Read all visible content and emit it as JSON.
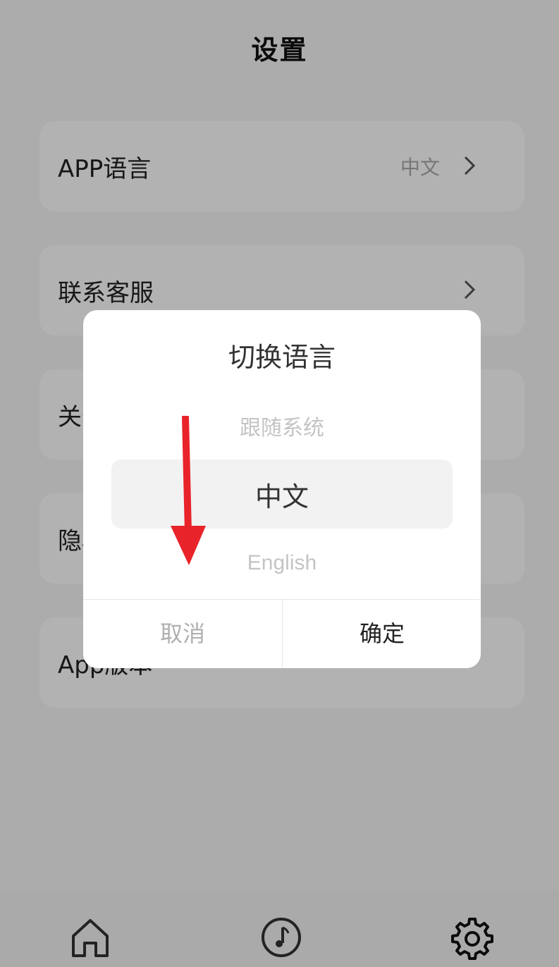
{
  "header": {
    "title": "设置"
  },
  "settings": {
    "items": [
      {
        "label": "APP语言",
        "value": "中文"
      },
      {
        "label": "联系客服",
        "value": ""
      },
      {
        "label": "关于我们",
        "value": ""
      },
      {
        "label": "隐私政策",
        "value": ""
      },
      {
        "label": "App版本",
        "value": ""
      }
    ]
  },
  "bottom_nav": {
    "items": [
      {
        "icon": "home-icon",
        "active": false
      },
      {
        "icon": "music-note-icon",
        "active": false
      },
      {
        "icon": "gear-icon",
        "active": true
      }
    ]
  },
  "dialog": {
    "title": "切换语言",
    "options": [
      "跟随系统",
      "中文",
      "English"
    ],
    "selected": "中文",
    "cancel_label": "取消",
    "confirm_label": "确定"
  },
  "annotation": {
    "arrow_color": "#e8242a"
  },
  "colors": {
    "background": "#f7f7f7",
    "card": "#ffffff",
    "overlay": "rgba(0,0,0,0.30)"
  }
}
